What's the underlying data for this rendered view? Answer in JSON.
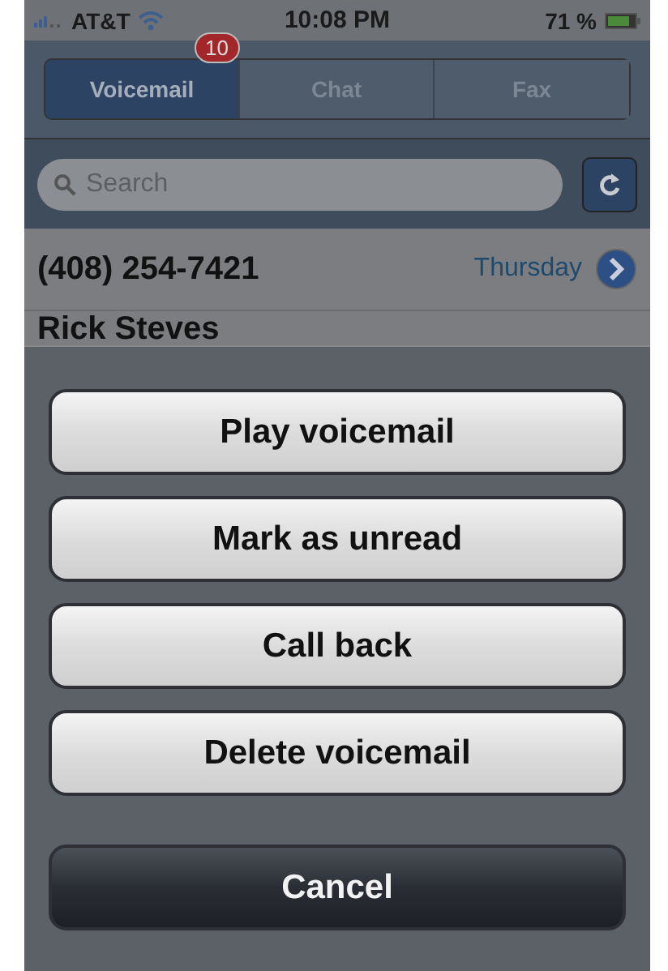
{
  "status_bar": {
    "carrier": "AT&T",
    "time": "10:08 PM",
    "battery": "71 %"
  },
  "tabs": [
    {
      "label": "Voicemail",
      "selected": true,
      "badge": "10"
    },
    {
      "label": "Chat",
      "selected": false
    },
    {
      "label": "Fax",
      "selected": false
    }
  ],
  "search": {
    "placeholder": "Search"
  },
  "rows": [
    {
      "title": "(408) 254-7421",
      "detail": "Thursday"
    },
    {
      "title": "Rick Steves"
    }
  ],
  "action_sheet": {
    "buttons": [
      {
        "label": "Play voicemail",
        "kind": "default"
      },
      {
        "label": "Mark as unread",
        "kind": "default"
      },
      {
        "label": "Call back",
        "kind": "default"
      },
      {
        "label": "Delete voicemail",
        "kind": "default"
      },
      {
        "label": "Cancel",
        "kind": "cancel"
      }
    ]
  }
}
